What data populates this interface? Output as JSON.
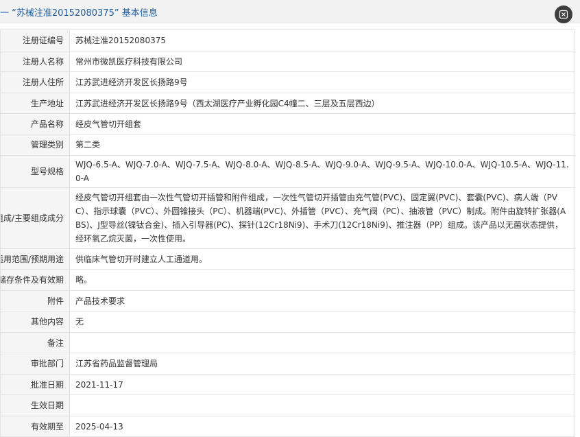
{
  "header": {
    "title": "一 “苏械注准20152080375” 基本信息",
    "close_icon": "close-icon"
  },
  "rows": [
    {
      "label": "注册证编号",
      "value": "苏械注准20152080375"
    },
    {
      "label": "注册人名称",
      "value": "常州市微凯医疗科技有限公司"
    },
    {
      "label": "注册人住所",
      "value": "江苏武进经济开发区长扬路9号"
    },
    {
      "label": "生产地址",
      "value": "江苏武进经济开发区长扬路9号（西太湖医疗产业孵化园C4幢二、三层及五层西边）"
    },
    {
      "label": "产品名称",
      "value": "经皮气管切开组套"
    },
    {
      "label": "管理类别",
      "value": "第二类"
    },
    {
      "label": "型号规格",
      "value": "WJQ-6.5-A、WJQ-7.0-A、WJQ-7.5-A、WJQ-8.0-A、WJQ-8.5-A、WJQ-9.0-A、WJQ-9.5-A、WJQ-10.0-A、WJQ-10.5-A、WJQ-11.0-A"
    },
    {
      "label": "结构及组成/主要组成成分",
      "value": "经皮气管切开组套由一次性气管切开插管和附件组成，一次性气管切开插管由充气管(PVC)、固定翼(PVC)、套囊(PVC)、病人端（PVC）、指示球囊（PVC）、外圆锥接头（PC）、机器端(PVC)、外插管（PVC）、充气阀（PC）、抽液管（PVC）制成。附件由旋转扩张器(ABS)、J型导丝(镍钛合金)、插入引导器(PC)、探针(12Cr18Ni9)、手术刀(12Cr18Ni9)、推注器（PP）组成。该产品以无菌状态提供，经环氧乙烷灭菌，一次性使用。"
    },
    {
      "label": "适用范围/预期用途",
      "value": "供临床气管切开时建立人工通道用。"
    },
    {
      "label": "产品储存条件及有效期",
      "value": "略。"
    },
    {
      "label": "附件",
      "value": "产品技术要求"
    },
    {
      "label": "其他内容",
      "value": "无"
    },
    {
      "label": "备注",
      "value": ""
    },
    {
      "label": "审批部门",
      "value": "江苏省药品监督管理局"
    },
    {
      "label": "批准日期",
      "value": "2021-11-17"
    },
    {
      "label": "生效日期",
      "value": ""
    },
    {
      "label": "有效期至",
      "value": "2025-04-13"
    }
  ]
}
